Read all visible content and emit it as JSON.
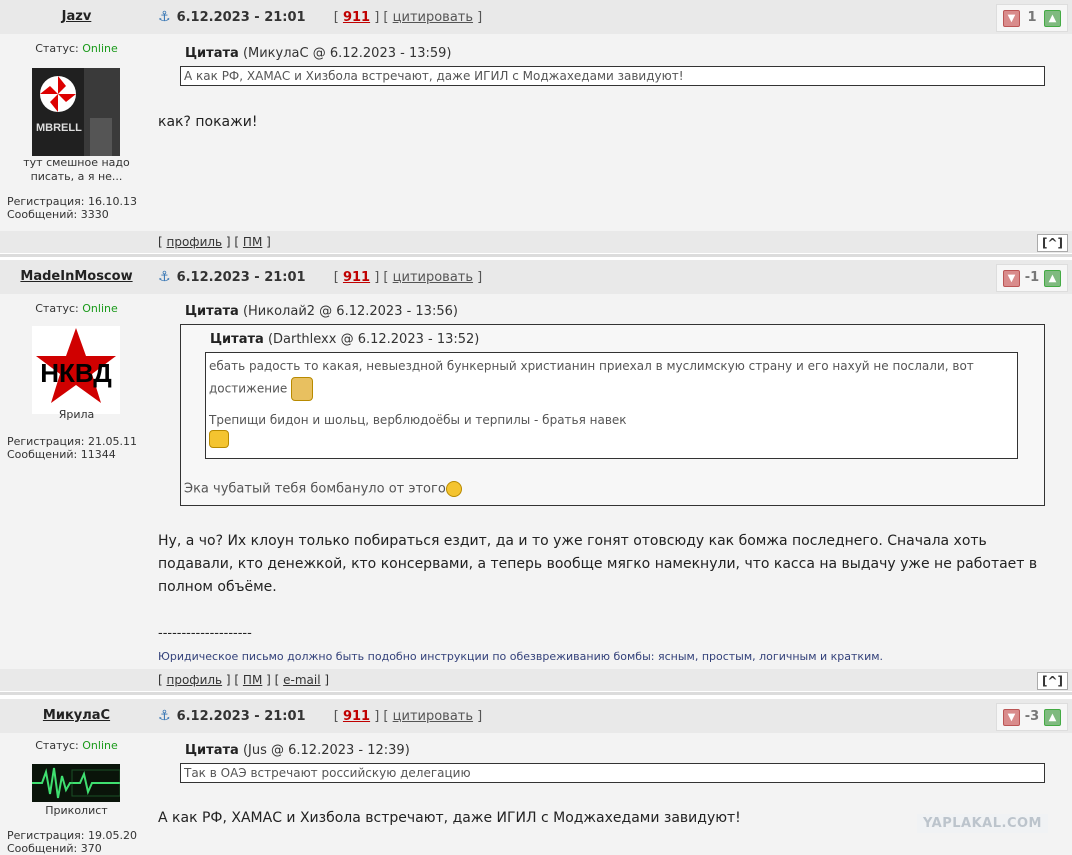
{
  "posts": [
    {
      "author": "Jazv",
      "date": "6.12.2023 - 21:01",
      "post_num": "911",
      "quote_label": "цитировать",
      "rating": "1",
      "status_label": "Статус:",
      "status_value": "Online",
      "user_title": "тут смешное надо писать, а я не...",
      "reg": "Регистрация: 16.10.13",
      "msgs": "Сообщений: 3330",
      "quote_title": "Цитата",
      "quote_meta": "(МикулаС @ 6.12.2023 - 13:59)",
      "quote_text": "А как РФ, ХАМАС и Хизбола встречают, даже ИГИЛ с Моджахедами завидуют!",
      "body": "как? покажи!",
      "footer_profile": "профиль",
      "footer_pm": "ПМ"
    },
    {
      "author": "MadeInMoscow",
      "date": "6.12.2023 - 21:01",
      "post_num": "911",
      "quote_label": "цитировать",
      "rating": "-1",
      "status_label": "Статус:",
      "status_value": "Online",
      "avatar_text": "НКВД",
      "user_title": "Ярила",
      "reg": "Регистрация: 21.05.11",
      "msgs": "Сообщений: 11344",
      "quote_title": "Цитата",
      "quote_meta": "(Николай2 @ 6.12.2023 - 13:56)",
      "inner_quote_title": "Цитата",
      "inner_quote_meta": "(Darthlexx @ 6.12.2023 - 13:52)",
      "inner_line1": "ебать радость то какая, невыездной бункерный христианин приехал в муслимскую страну и его нахуй не послали, вот достижение",
      "inner_line2": "Трепищи бидон и шольц, верблюдоёбы и терпилы - братья навек",
      "outer_reply": "Эка чубатый тебя бомбануло от этого",
      "body1": "Ну, а чо? Их клоун только побираться ездит, да и то уже гонят отовсюду как бомжа последнего. Сначала хоть подавали, кто денежкой, кто консервами, а теперь вообще мягко намекнули, что касса на выдачу уже не работает в полном объёме.",
      "sig_dash": "--------------------",
      "signature": "Юридическое письмо должно быть подобно инструкции по обезвреживанию бомбы: ясным, простым, логичным и кратким.",
      "footer_profile": "профиль",
      "footer_pm": "ПМ",
      "footer_email": "e-mail"
    },
    {
      "author": "МикулаС",
      "date": "6.12.2023 - 21:01",
      "post_num": "911",
      "quote_label": "цитировать",
      "rating": "-3",
      "status_label": "Статус:",
      "status_value": "Online",
      "user_title": "Приколист",
      "reg": "Регистрация: 19.05.20",
      "msgs": "Сообщений: 370",
      "quote_title": "Цитата",
      "quote_meta": "(Jus @ 6.12.2023 - 12:39)",
      "quote_text": "Так в ОАЭ встречают российскую делегацию",
      "body": "А как РФ, ХАМАС и Хизбола встречают, даже ИГИЛ с Моджахедами завидуют!"
    }
  ],
  "up_label": "[^]",
  "watermark": "YAPLAKAL.COM",
  "colors": {
    "online": "#1a9a1a",
    "post_num": "#c00000",
    "header_bg": "#e9e9e9",
    "body_bg": "#f3f3f3"
  }
}
